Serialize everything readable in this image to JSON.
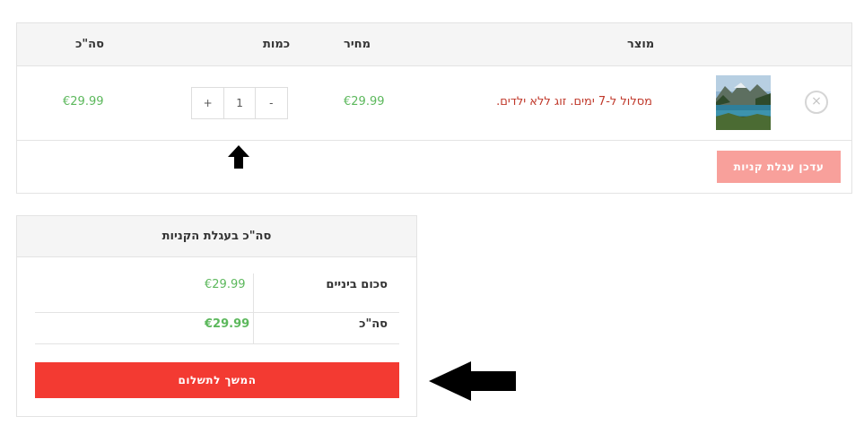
{
  "cart": {
    "headers": {
      "product": "מוצר",
      "price": "מחיר",
      "quantity": "כמות",
      "subtotal": "סה\"כ"
    },
    "item": {
      "remove_icon": "×",
      "name": "מסלול ל-7 ימים. זוג ללא ילדים.",
      "price": "€29.99",
      "quantity": "1",
      "increase_label": "+",
      "decrease_label": "-",
      "subtotal": "€29.99"
    },
    "update_label": "עדכן עגלת קניות"
  },
  "totals": {
    "title": "סה\"כ בעגלת הקניות",
    "subtotal_label": "סכום ביניים",
    "subtotal_value": "€29.99",
    "total_label": "סה\"כ",
    "total_value": "€29.99",
    "checkout_label": "המשך לתשלום"
  },
  "colors": {
    "price_green": "#5cb85c",
    "product_red": "#c0392b",
    "update_button": "#f8a09b",
    "checkout_button": "#f33a32"
  }
}
